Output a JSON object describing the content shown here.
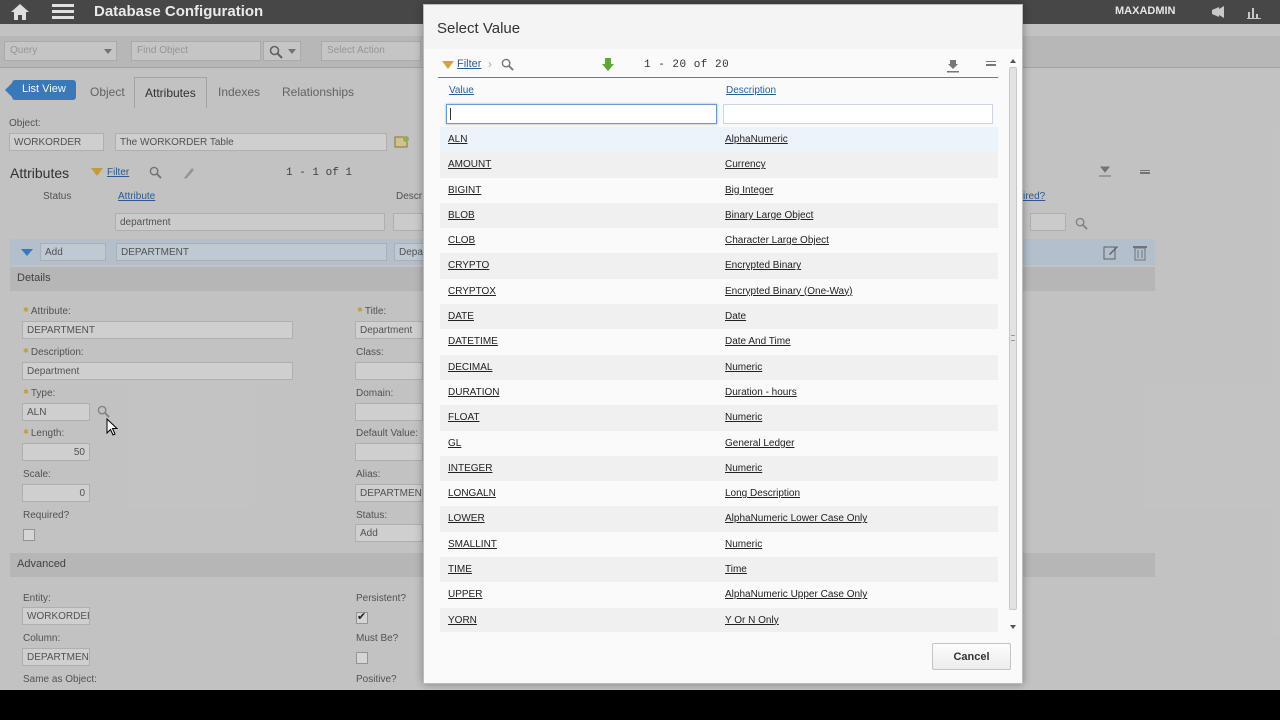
{
  "app": {
    "title": "Database Configuration",
    "user": "MAXADMIN",
    "toolbar": {
      "query_placeholder": "Query",
      "find_placeholder": "Find Object",
      "action_placeholder": "Select Action"
    },
    "tabs": {
      "list_view": "List View",
      "items": [
        "Object",
        "Attributes",
        "Indexes",
        "Relationships"
      ],
      "active": "Attributes"
    },
    "object": {
      "label": "Object:",
      "value": "WORKORDER",
      "description": "The WORKORDER Table"
    },
    "attributes_section": {
      "title": "Attributes",
      "filter": "Filter",
      "pager": "1 - 1 of 1",
      "col_status": "Status",
      "col_attribute": "Attribute",
      "col_description": "Descr",
      "col_required": "ired?",
      "filter_attribute": "department",
      "row_status": "Add",
      "row_attribute": "DEPARTMENT",
      "row_description": "Depar"
    },
    "details": {
      "header": "Details",
      "attribute_label": "Attribute:",
      "attribute_value": "DEPARTMENT",
      "description_label": "Description:",
      "description_value": "Department",
      "type_label": "Type:",
      "type_value": "ALN",
      "length_label": "Length:",
      "length_value": "50",
      "scale_label": "Scale:",
      "scale_value": "0",
      "required_label": "Required?",
      "title_label": "Title:",
      "title_value": "Department",
      "class_label": "Class:",
      "domain_label": "Domain:",
      "default_label": "Default Value:",
      "alias_label": "Alias:",
      "alias_value": "DEPARTMENT",
      "status_label": "Status:",
      "status_value": "Add"
    },
    "advanced": {
      "header": "Advanced",
      "entity_label": "Entity:",
      "entity_value": "WORKORDER",
      "column_label": "Column:",
      "column_value": "DEPARTMENT",
      "same_as_label": "Same as Object:",
      "persistent_label": "Persistent?",
      "mustbe_label": "Must Be?",
      "positive_label": "Positive?"
    }
  },
  "dialog": {
    "title": "Select Value",
    "filter_label": "Filter",
    "pager": "1 - 20 of 20",
    "col_value": "Value",
    "col_description": "Description",
    "filter_value": "",
    "filter_description": "",
    "cancel_label": "Cancel",
    "rows": [
      {
        "value": "ALN",
        "description": "AlphaNumeric"
      },
      {
        "value": "AMOUNT",
        "description": "Currency"
      },
      {
        "value": "BIGINT",
        "description": "Big Integer"
      },
      {
        "value": "BLOB",
        "description": "Binary Large Object"
      },
      {
        "value": "CLOB",
        "description": "Character Large Object"
      },
      {
        "value": "CRYPTO",
        "description": "Encrypted Binary"
      },
      {
        "value": "CRYPTOX",
        "description": "Encrypted Binary (One-Way)"
      },
      {
        "value": "DATE",
        "description": "Date"
      },
      {
        "value": "DATETIME",
        "description": "Date And Time"
      },
      {
        "value": "DECIMAL",
        "description": "Numeric"
      },
      {
        "value": "DURATION",
        "description": "Duration - hours"
      },
      {
        "value": "FLOAT",
        "description": "Numeric"
      },
      {
        "value": "GL",
        "description": "General Ledger"
      },
      {
        "value": "INTEGER",
        "description": "Numeric"
      },
      {
        "value": "LONGALN",
        "description": "Long Description"
      },
      {
        "value": "LOWER",
        "description": "AlphaNumeric Lower Case Only"
      },
      {
        "value": "SMALLINT",
        "description": "Numeric"
      },
      {
        "value": "TIME",
        "description": "Time"
      },
      {
        "value": "UPPER",
        "description": "AlphaNumeric Upper Case Only"
      },
      {
        "value": "YORN",
        "description": "Y Or N Only"
      }
    ]
  },
  "colors": {
    "accent": "#3c7dbd",
    "link": "#2b5d9b",
    "topbar": "#4a4a4a",
    "filter_icon": "#d4a338",
    "green_arrow": "#5aa832"
  }
}
